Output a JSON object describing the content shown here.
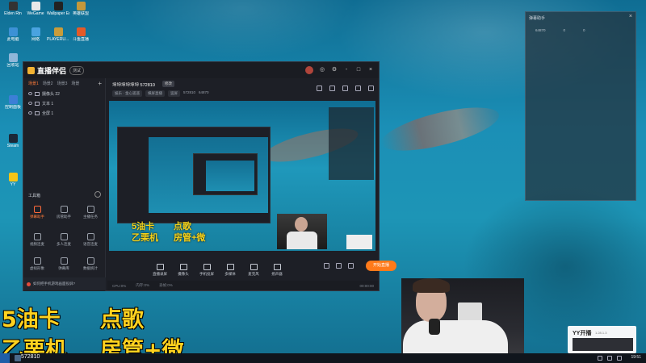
{
  "desktop": {
    "icons": [
      {
        "label": "Elden Rin",
        "icon": "game-icon"
      },
      {
        "label": "WeGame",
        "icon": "wegame-icon"
      },
      {
        "label": "Wallpaper Engine",
        "icon": "wallpaper-icon"
      },
      {
        "label": "英雄联盟",
        "icon": "league-icon"
      },
      {
        "label": "此电脑",
        "icon": "computer-icon"
      },
      {
        "label": "网络",
        "icon": "network-icon"
      },
      {
        "label": "PLAYERU... BATTLEGR...",
        "icon": "pubg-icon"
      },
      {
        "label": "斗鱼直播",
        "icon": "douyu-icon"
      },
      {
        "label": "回收站",
        "icon": "recycle-bin-icon"
      },
      {
        "label": "控制面板",
        "icon": "control-panel-icon"
      },
      {
        "label": "Steam",
        "icon": "steam-icon"
      },
      {
        "label": "YY",
        "icon": "yy-icon"
      }
    ]
  },
  "app": {
    "logo_text": "直播伴侣",
    "version_badge": "测试",
    "title_buttons": [
      "avatar",
      "-",
      "□",
      "×"
    ],
    "scene_tabs": [
      "场景1",
      "场景2",
      "场景3",
      "场景"
    ],
    "add_scene": "+",
    "sources": [
      {
        "label": "摄像头 22",
        "icon": "camera-icon"
      },
      {
        "label": "文本 1",
        "icon": "text-icon"
      },
      {
        "label": "全屏 1",
        "icon": "screen-icon"
      }
    ],
    "tools_title": "工具箱",
    "tools": [
      {
        "label": "弹幕助手",
        "hot": true
      },
      {
        "label": "房管助手",
        "hot": false
      },
      {
        "label": "主播任务",
        "hot": false
      },
      {
        "label": "视频连麦",
        "hot": false
      },
      {
        "label": "多人连麦",
        "hot": false
      },
      {
        "label": "语音连麦",
        "hot": false
      },
      {
        "label": "虚拟形象",
        "hot": false
      },
      {
        "label": "弹幕库",
        "hot": false
      },
      {
        "label": "数据统计",
        "hot": false
      }
    ],
    "notice_text": "如何把手机游戏画面投屏?",
    "room_name": "坤坤坤坤坤坤",
    "room_id": "572810",
    "edit_tag": "修改",
    "meta": [
      "娱乐 · 金心遥遥",
      "横屏直播",
      "竖屏"
    ],
    "meta_id": "572810",
    "meta_fans": "64870",
    "toolbar": [
      {
        "label": "直播录屏",
        "icon": "screen-record-icon"
      },
      {
        "label": "摄像头",
        "icon": "camera-icon"
      },
      {
        "label": "手机投屏",
        "icon": "phone-cast-icon"
      },
      {
        "label": "多媒体",
        "icon": "media-icon"
      },
      {
        "label": "麦克风",
        "icon": "mic-icon"
      },
      {
        "label": "扬声器",
        "icon": "speaker-icon"
      }
    ],
    "start_live": "开始直播",
    "status": [
      "00:00:00",
      "CPU:0%",
      "内存:0%",
      "丢帧:0%"
    ],
    "time": "00:00:00"
  },
  "preview": {
    "overlay_line1_a": "5油卡",
    "overlay_line1_b": "点歌",
    "overlay_line2_a": "乙栗机",
    "overlay_line2_b": "房管+微"
  },
  "float_panel": {
    "title": "弹幕助手",
    "stats": [
      "64870",
      "0",
      "0"
    ]
  },
  "overlay": {
    "line1_left": "5油卡",
    "line1_right": "点歌",
    "line2_left": "乙栗机",
    "line2_right": "房管+微"
  },
  "taskbar": {
    "id_text": "572810",
    "clock": "19:51"
  },
  "yy_popup": {
    "logo": "YY开播",
    "version": "1.28.1.3"
  }
}
